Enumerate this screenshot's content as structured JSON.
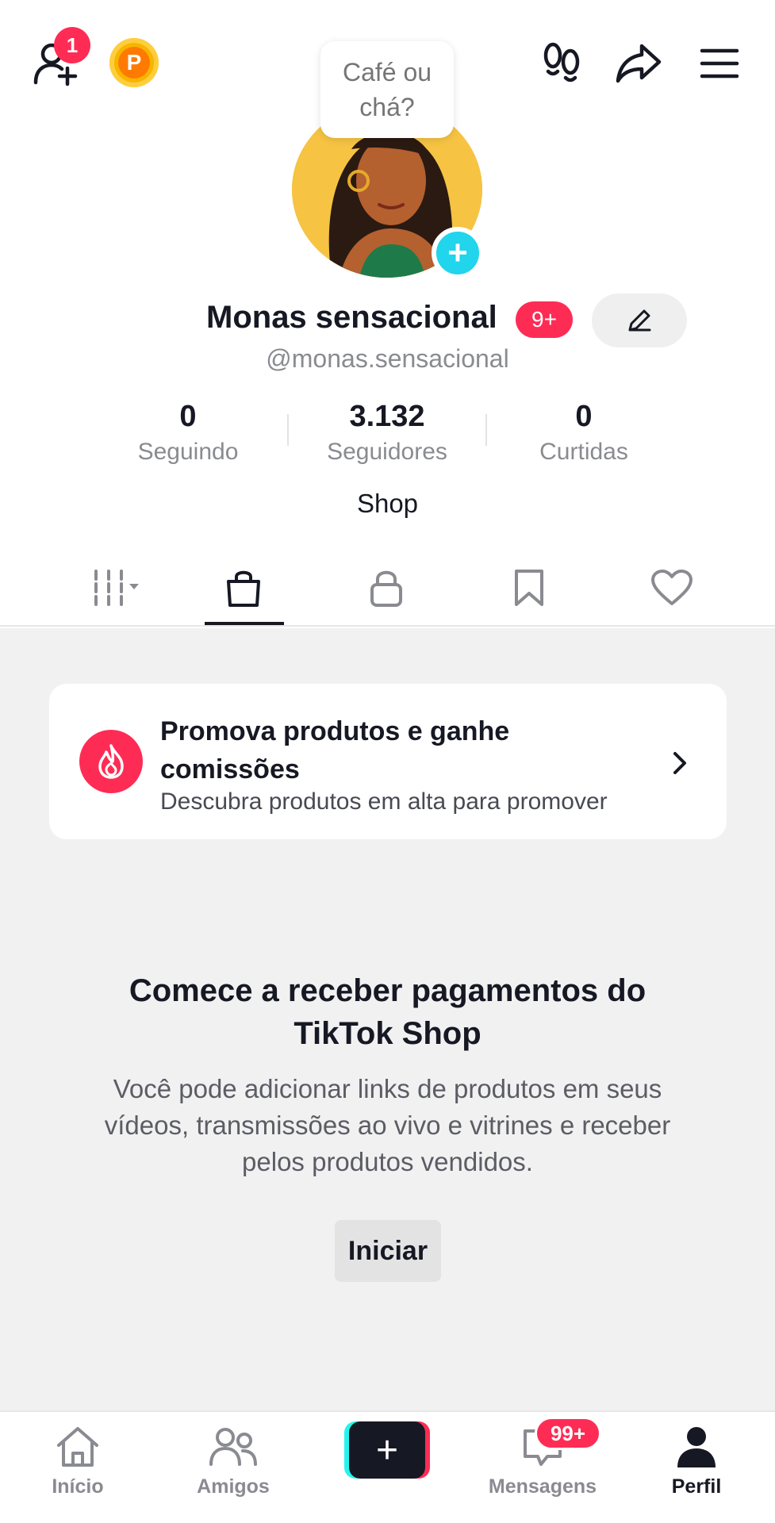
{
  "header": {
    "add_friend_badge": "1",
    "coin_letter": "P",
    "icons": [
      "add-friend-icon",
      "coin-icon",
      "footprints-icon",
      "share-icon",
      "menu-icon"
    ]
  },
  "profile": {
    "note_bubble": "Café ou chá?",
    "name": "Monas sensacional",
    "name_badge": "9+",
    "handle": "@monas.sensacional",
    "bio": "Shop"
  },
  "stats": [
    {
      "value": "0",
      "label": "Seguindo"
    },
    {
      "value": "3.132",
      "label": "Seguidores"
    },
    {
      "value": "0",
      "label": "Curtidas"
    }
  ],
  "tabs": [
    {
      "icon": "grid-icon",
      "active": false
    },
    {
      "icon": "shopping-bag-icon",
      "active": true
    },
    {
      "icon": "lock-icon",
      "active": false
    },
    {
      "icon": "bookmark-icon",
      "active": false
    },
    {
      "icon": "heart-icon",
      "active": false
    }
  ],
  "promo": {
    "title": "Promova produtos e ganhe comissões",
    "subtitle": "Descubra produtos em alta para promover"
  },
  "shop_empty": {
    "title": "Comece a receber pagamentos do TikTok Shop",
    "description": "Você pode adicionar links de produtos em seus vídeos, transmissões ao vivo e vitrines e receber pelos produtos vendidos.",
    "button": "Iniciar"
  },
  "bottom_nav": {
    "home": "Início",
    "friends": "Amigos",
    "messages": "Mensagens",
    "messages_badge": "99+",
    "profile": "Perfil",
    "create_symbol": "+"
  },
  "colors": {
    "accent": "#fe2c55",
    "cyan": "#25f4ee",
    "text": "#161823",
    "muted": "#8a8b91",
    "bg_content": "#f1f1f2"
  }
}
